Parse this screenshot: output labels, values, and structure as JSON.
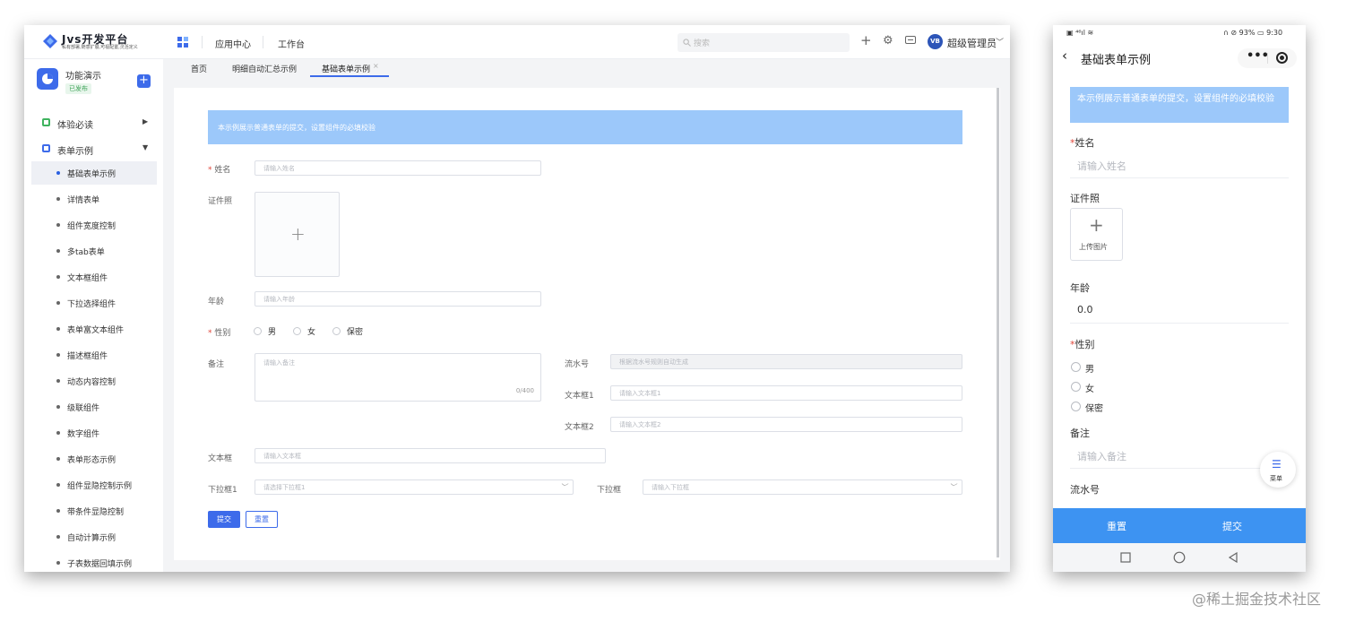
{
  "desktop": {
    "logo": {
      "title": "Jvs开发平台",
      "subtitle": "私有部署,随意扩展,可视配置,灵活定义"
    },
    "nav": {
      "app_center": "应用中心",
      "workbench": "工作台"
    },
    "search": {
      "placeholder": "搜索"
    },
    "user": {
      "avatar": "VB",
      "name": "超级管理员"
    },
    "app": {
      "name": "功能演示",
      "badge": "已发布"
    },
    "sidebar": {
      "groups": [
        {
          "label": "体验必读",
          "color": "#3fb35e"
        },
        {
          "label": "表单示例",
          "color": "#3d6bea"
        }
      ],
      "items": [
        {
          "label": "基础表单示例"
        },
        {
          "label": "详情表单"
        },
        {
          "label": "组件宽度控制"
        },
        {
          "label": "多tab表单"
        },
        {
          "label": "文本框组件"
        },
        {
          "label": "下拉选择组件"
        },
        {
          "label": "表单富文本组件"
        },
        {
          "label": "描述框组件"
        },
        {
          "label": "动态内容控制"
        },
        {
          "label": "级联组件"
        },
        {
          "label": "数字组件"
        },
        {
          "label": "表单形态示例"
        },
        {
          "label": "组件显隐控制示例"
        },
        {
          "label": "带条件显隐控制"
        },
        {
          "label": "自动计算示例"
        },
        {
          "label": "子表数据回填示例"
        }
      ]
    },
    "tabs": [
      {
        "label": "首页"
      },
      {
        "label": "明细自动汇总示例"
      },
      {
        "label": "基础表单示例"
      }
    ],
    "form": {
      "info": "本示例展示普通表单的提交，设置组件的必填校验",
      "name": {
        "label": "姓名",
        "placeholder": "请输入姓名"
      },
      "photo": {
        "label": "证件照"
      },
      "age": {
        "label": "年龄",
        "placeholder": "请输入年龄"
      },
      "gender": {
        "label": "性别",
        "options": [
          "男",
          "女",
          "保密"
        ]
      },
      "remark": {
        "label": "备注",
        "placeholder": "请输入备注",
        "counter": "0/400"
      },
      "serial": {
        "label": "流水号",
        "placeholder": "根据流水号规则自动生成"
      },
      "text1": {
        "label": "文本框1",
        "placeholder": "请输入文本框1"
      },
      "text2": {
        "label": "文本框2",
        "placeholder": "请输入文本框2"
      },
      "text": {
        "label": "文本框",
        "placeholder": "请输入文本框"
      },
      "select1": {
        "label": "下拉框1",
        "placeholder": "请选择下拉框1"
      },
      "select": {
        "label": "下拉框",
        "placeholder": "请输入下拉框"
      },
      "submit": "提交",
      "reset": "重置"
    }
  },
  "mobile": {
    "status": {
      "left": "▣ ⁴⁶ıl ≋",
      "right": "∩ ⊘ 93% ▭ 9:30"
    },
    "title": "基础表单示例",
    "info": "本示例展示普通表单的提交，设置组件的必填校验",
    "name": {
      "label": "姓名",
      "placeholder": "请输入姓名"
    },
    "photo": {
      "label": "证件照",
      "upload": "上传图片"
    },
    "age": {
      "label": "年龄",
      "value": "0.0"
    },
    "gender": {
      "label": "性别",
      "options": [
        "男",
        "女",
        "保密"
      ]
    },
    "remark": {
      "label": "备注",
      "placeholder": "请输入备注"
    },
    "serial": {
      "label": "流水号"
    },
    "fab": "菜单",
    "reset": "重置",
    "submit": "提交"
  },
  "watermark": "@稀土掘金技术社区",
  "colors": {
    "primary": "#3d6bea",
    "info_bg": "#9cc8fa",
    "required": "#e0463a",
    "mobile_bar": "#3d93f2"
  }
}
